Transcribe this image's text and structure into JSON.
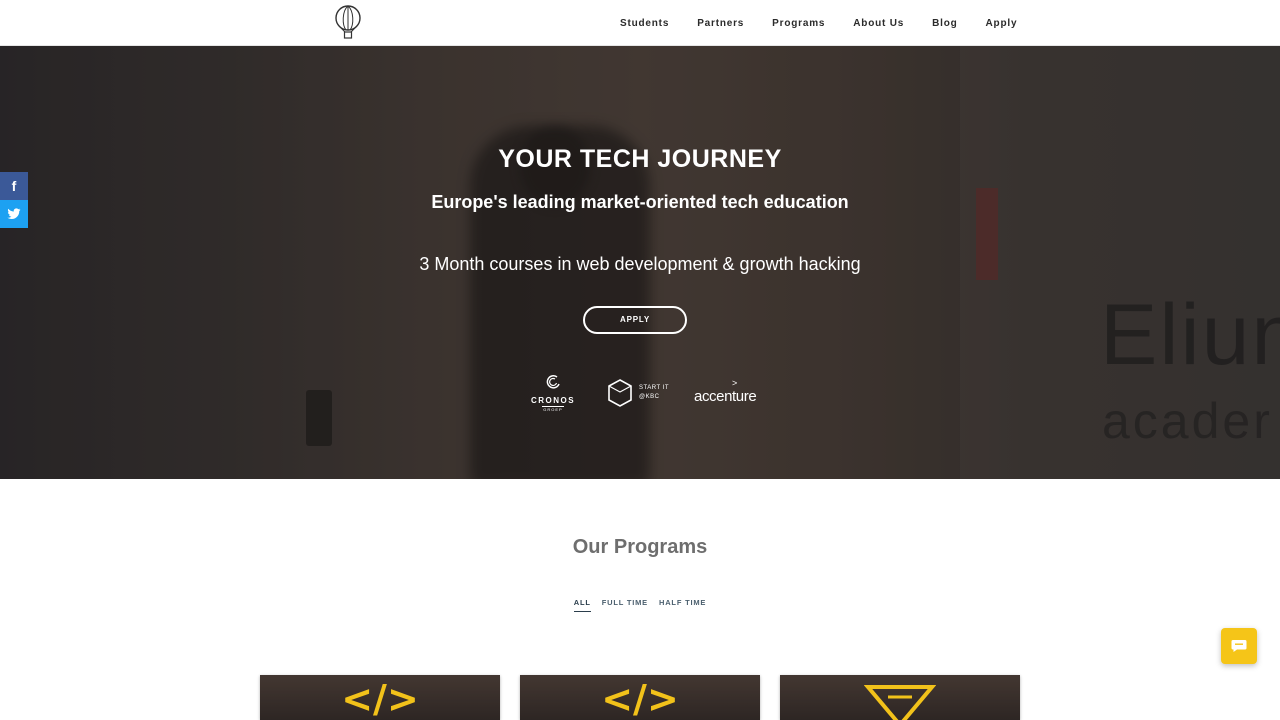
{
  "header": {
    "logo_icon": "hot-air-balloon-icon",
    "nav": [
      "Students",
      "Partners",
      "Programs",
      "About Us",
      "Blog",
      "Apply"
    ]
  },
  "hero": {
    "title": "YOUR TECH JOURNEY",
    "subtitle": "Europe's leading market-oriented tech education",
    "description": "3 Month courses in web development & growth hacking",
    "apply_label": "APPLY",
    "background_text": [
      "Eliun",
      "acader"
    ],
    "partners": {
      "cronos": {
        "name": "CRONOS",
        "sub": "GROEP"
      },
      "startit": {
        "line1": "START IT",
        "line2": "@KBC"
      },
      "accenture": {
        "name": "accenture",
        "mark": ">"
      }
    }
  },
  "social": {
    "facebook_icon": "facebook-icon",
    "facebook_glyph": "f",
    "twitter_icon": "twitter-icon",
    "colors": {
      "facebook": "#3b5998",
      "twitter": "#1da1f2"
    }
  },
  "programs": {
    "title": "Our Programs",
    "filters": [
      "ALL",
      "FULL TIME",
      "HALF TIME"
    ],
    "active_filter": "ALL",
    "cards": [
      {
        "icon": "code-icon",
        "glyph": "</>"
      },
      {
        "icon": "code-icon",
        "glyph": "</>"
      },
      {
        "icon": "funnel-icon",
        "glyph": ""
      }
    ],
    "accent_color": "#f2c21a"
  },
  "chat": {
    "icon": "chat-bubble-icon",
    "color": "#f5c518"
  }
}
